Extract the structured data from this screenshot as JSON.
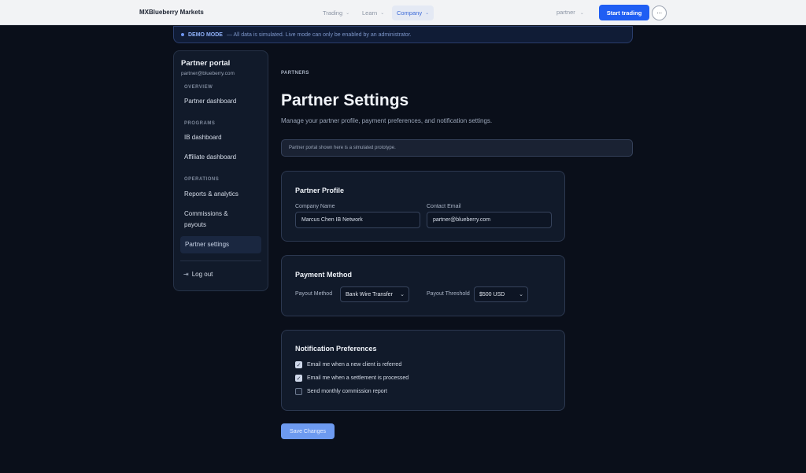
{
  "topnav": {
    "brand": "MXBlueberry Markets",
    "items": [
      {
        "label": "Trading"
      },
      {
        "label": "Learn"
      },
      {
        "label": "Company"
      }
    ],
    "chevron": "⌄",
    "partner_label": "partner",
    "start_label": "Start trading",
    "more_label": "···"
  },
  "demo": {
    "label": "DEMO MODE",
    "message": "— All data is simulated. Live mode can only be enabled by an administrator."
  },
  "sidebar": {
    "title": "Partner portal",
    "email": "partner@blueberry.com",
    "sections": [
      "OVERVIEW",
      "PROGRAMS",
      "OPERATIONS"
    ],
    "items": [
      {
        "label": "Partner dashboard"
      },
      {
        "label": "IB dashboard"
      },
      {
        "label": "Affiliate dashboard"
      },
      {
        "label": "Reports & analytics"
      },
      {
        "label": "Commissions &"
      },
      {
        "label": "payouts"
      },
      {
        "label": "Partner settings"
      }
    ],
    "logout_icon": "⇥",
    "logout_label": "Log out"
  },
  "main": {
    "breadcrumb": "PARTNERS",
    "title": "Partner Settings",
    "subtitle": "Manage your partner profile, payment preferences, and notification settings.",
    "notice": "Partner portal shown here is a simulated prototype."
  },
  "profile": {
    "title": "Partner Profile",
    "company_label": "Company Name",
    "company_value": "Marcus Chen IB Network",
    "email_label": "Contact Email",
    "email_value": "partner@blueberry.com"
  },
  "payment": {
    "title": "Payment Method",
    "method_label": "Payout Method",
    "method_value": "Bank Wire Transfer",
    "threshold_label": "Payout Threshold",
    "threshold_value": "$500 USD",
    "caret": "⌄"
  },
  "notifications": {
    "title": "Notification Preferences",
    "options": [
      {
        "label": "Email me when a new client is referred",
        "checked": true
      },
      {
        "label": "Email me when a settlement is processed",
        "checked": true
      },
      {
        "label": "Send monthly commission report",
        "checked": false
      }
    ],
    "check_glyph": "✓"
  },
  "save_label": "Save Changes",
  "colors": {
    "background": "#0a0f1a",
    "accent": "#1f5ef3",
    "card": "#111a2a"
  }
}
